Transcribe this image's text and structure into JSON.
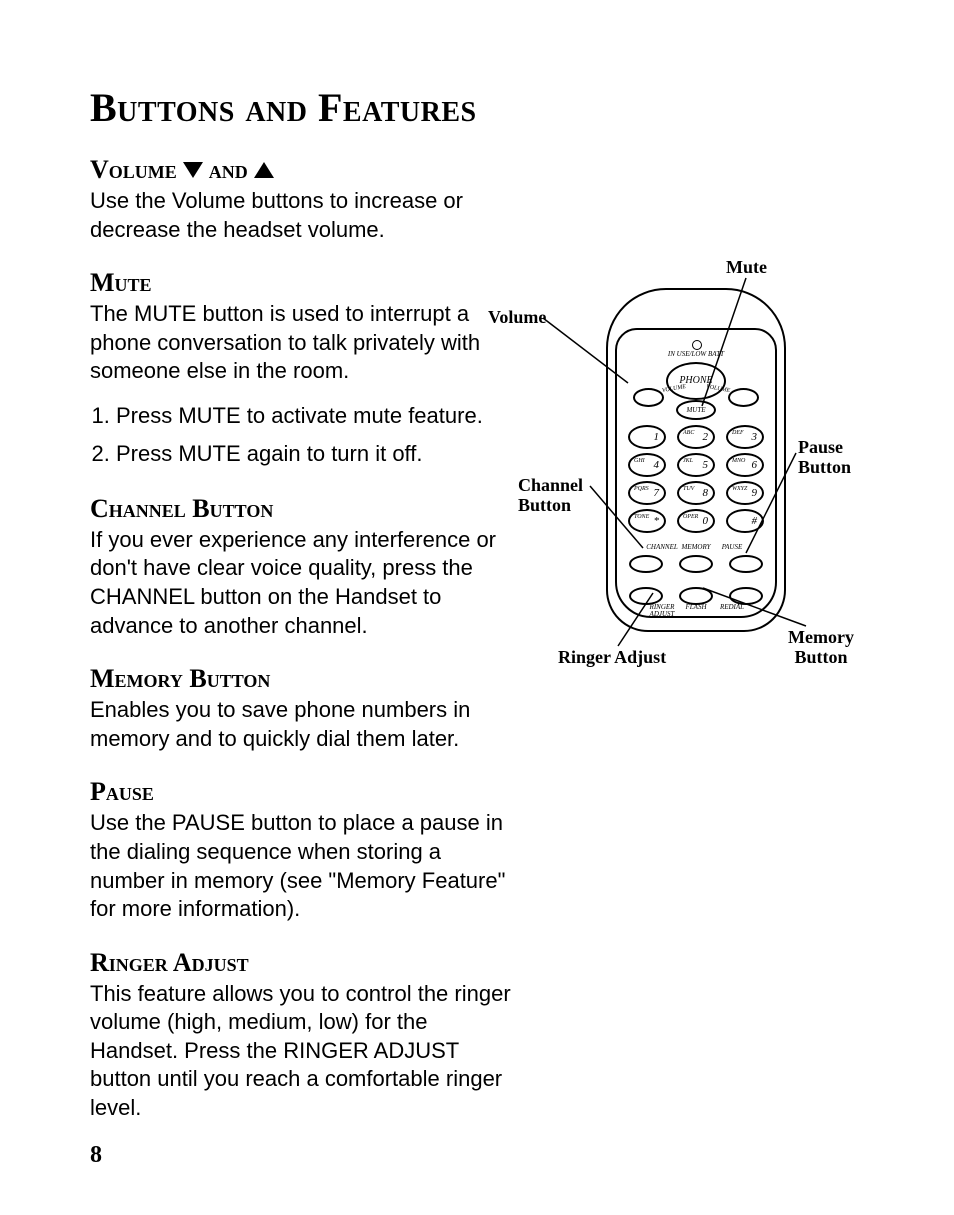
{
  "title": "Buttons and Features",
  "pageNo": "8",
  "sections": {
    "volume": {
      "heading_part1": "Volume",
      "heading_part2": "and",
      "body": "Use the Volume buttons to increase or decrease the headset volume."
    },
    "mute": {
      "heading": "Mute",
      "body": "The MUTE button is used to interrupt a phone conversation to talk privately with someone else in the room.",
      "steps": [
        "Press MUTE to activate mute feature.",
        "Press MUTE again to turn it off."
      ]
    },
    "channel": {
      "heading": "Channel Button",
      "body": "If you ever experience any interference or don't have clear voice quality, press the CHANNEL button on the Handset to advance to another channel."
    },
    "memory": {
      "heading": "Memory Button",
      "body": "Enables you to save phone numbers in memory and to quickly dial them later."
    },
    "pause": {
      "heading": "Pause",
      "body": "Use the PAUSE button to place a pause in the dialing sequence when storing a number in memory (see \"Memory Feature\" for more information)."
    },
    "ringer": {
      "heading": "Ringer Adjust",
      "body": "This feature allows you to control the ringer volume (high, medium, low) for the Handset. Press the RINGER ADJUST button until you reach a comfortable ringer level."
    }
  },
  "diagram": {
    "labels": {
      "mute": "Mute",
      "volume": "Volume",
      "channelButton": "Channel\nButton",
      "pauseButton": "Pause\nButton",
      "memoryButton": "Memory\nButton",
      "ringerAdjust": "Ringer Adjust"
    },
    "handset": {
      "led": "IN USE/LOW BATT",
      "phone": "PHONE",
      "volume": "VOLUME",
      "mute": "MUTE",
      "keys": [
        {
          "n": "1",
          "sub": ""
        },
        {
          "n": "2",
          "sub": "ABC"
        },
        {
          "n": "3",
          "sub": "DEF"
        },
        {
          "n": "4",
          "sub": "GHI"
        },
        {
          "n": "5",
          "sub": "JKL"
        },
        {
          "n": "6",
          "sub": "MNO"
        },
        {
          "n": "7",
          "sub": "PQRS"
        },
        {
          "n": "8",
          "sub": "TUV"
        },
        {
          "n": "9",
          "sub": "WXYZ"
        },
        {
          "n": "*",
          "sub": "TONE"
        },
        {
          "n": "0",
          "sub": "OPER"
        },
        {
          "n": "#",
          "sub": ""
        }
      ],
      "fnTop": [
        "CHANNEL",
        "MEMORY",
        "PAUSE"
      ],
      "fnBot": [
        "RINGER\nADJUST",
        "FLASH",
        "REDIAL"
      ]
    }
  }
}
